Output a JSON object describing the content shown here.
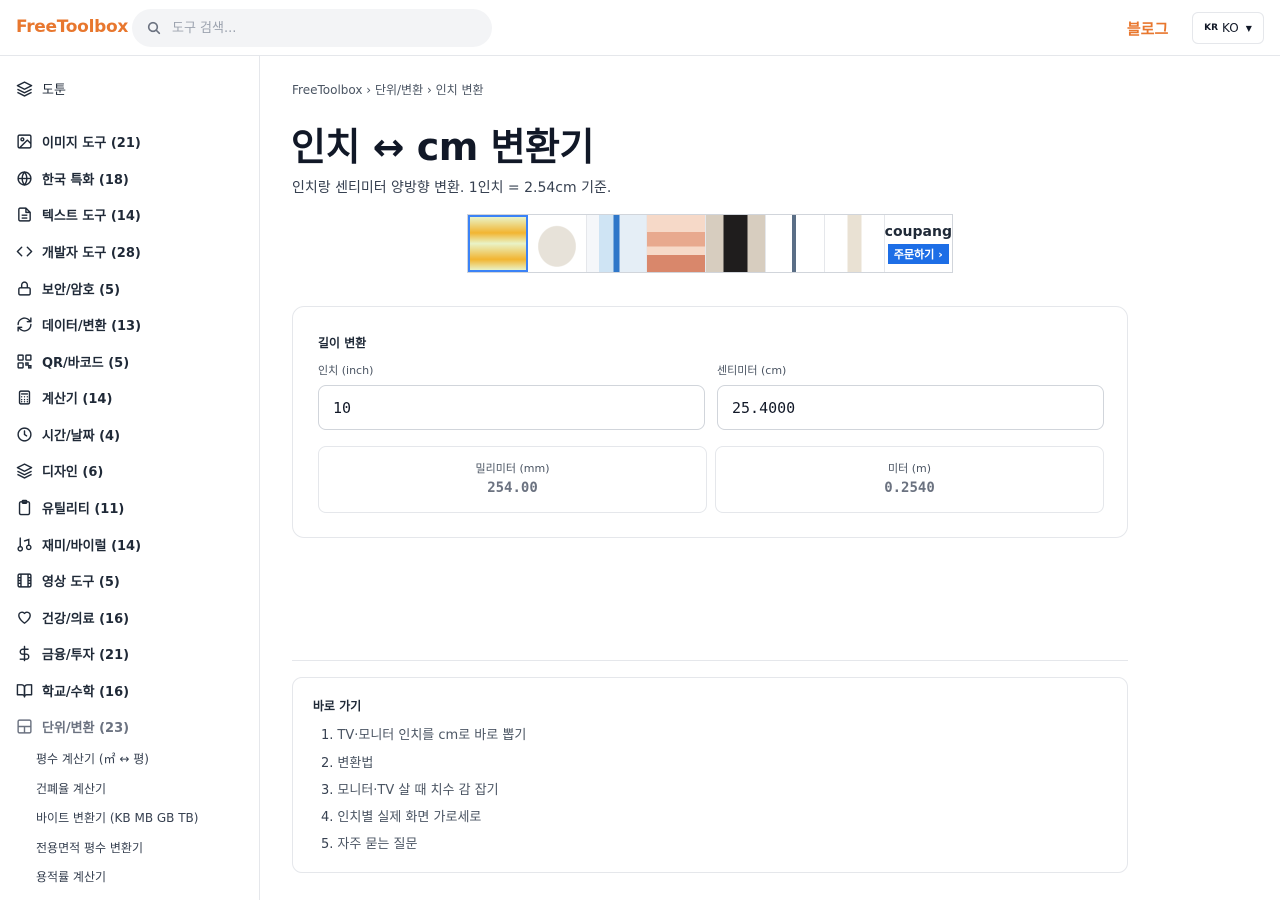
{
  "header": {
    "logo": "FreeToolbox",
    "search_placeholder": "도구 검색...",
    "blog_link": "블로그",
    "lang_flag": "KR",
    "lang_code": "KO"
  },
  "sidebar": {
    "top_item": "도툰",
    "categories": [
      {
        "label": "이미지 도구 (21)",
        "icon": "image-icon"
      },
      {
        "label": "한국 특화 (18)",
        "icon": "globe-icon"
      },
      {
        "label": "텍스트 도구 (14)",
        "icon": "document-icon"
      },
      {
        "label": "개발자 도구 (28)",
        "icon": "code-icon"
      },
      {
        "label": "보안/암호 (5)",
        "icon": "lock-icon"
      },
      {
        "label": "데이터/변환 (13)",
        "icon": "refresh-icon"
      },
      {
        "label": "QR/바코드 (5)",
        "icon": "qr-icon"
      },
      {
        "label": "계산기 (14)",
        "icon": "calculator-icon"
      },
      {
        "label": "시간/날짜 (4)",
        "icon": "clock-icon"
      },
      {
        "label": "디자인 (6)",
        "icon": "layers-icon"
      },
      {
        "label": "유틸리티 (11)",
        "icon": "clipboard-icon"
      },
      {
        "label": "재미/바이럴 (14)",
        "icon": "music-icon"
      },
      {
        "label": "영상 도구 (5)",
        "icon": "film-icon"
      },
      {
        "label": "건강/의료 (16)",
        "icon": "heart-icon"
      },
      {
        "label": "금융/투자 (21)",
        "icon": "dollar-icon"
      },
      {
        "label": "학교/수학 (16)",
        "icon": "book-icon"
      },
      {
        "label": "단위/변환 (23)",
        "icon": "grid-icon"
      }
    ],
    "sub_items": [
      "평수 계산기 (㎡ ↔ 평)",
      "건폐율 계산기",
      "바이트 변환기 (KB MB GB TB)",
      "전용면적 평수 변환기",
      "용적률 계산기"
    ]
  },
  "breadcrumb": {
    "home": "FreeToolbox",
    "sep": "›",
    "category": "단위/변환",
    "current": "인치 변환"
  },
  "page": {
    "title": "인치 ↔ cm 변환기",
    "description": "인치랑 센티미터 양방향 변환. 1인치 = 2.54cm 기준."
  },
  "ad": {
    "brand": "coupang",
    "button": "주문하기 ›"
  },
  "converter": {
    "title": "길이 변환",
    "inch_label": "인치 (inch)",
    "inch_value": "10",
    "cm_label": "센티미터 (cm)",
    "cm_value": "25.4000",
    "mm_label": "밀리미터 (mm)",
    "mm_value": "254.00",
    "m_label": "미터 (m)",
    "m_value": "0.2540"
  },
  "toc": {
    "title": "바로 가기",
    "items": [
      {
        "num": "1.",
        "label": "TV·모니터 인치를 cm로 바로 뽑기"
      },
      {
        "num": "2.",
        "label": "변환법"
      },
      {
        "num": "3.",
        "label": "모니터·TV 살 때 치수 감 잡기"
      },
      {
        "num": "4.",
        "label": "인치별 실제 화면 가로세로"
      },
      {
        "num": "5.",
        "label": "자주 묻는 질문"
      }
    ]
  },
  "colors": {
    "brand": "#e8772e",
    "border": "#e5e7eb",
    "text": "#111827",
    "muted": "#6b7280",
    "ad_button": "#1d6ee6"
  }
}
